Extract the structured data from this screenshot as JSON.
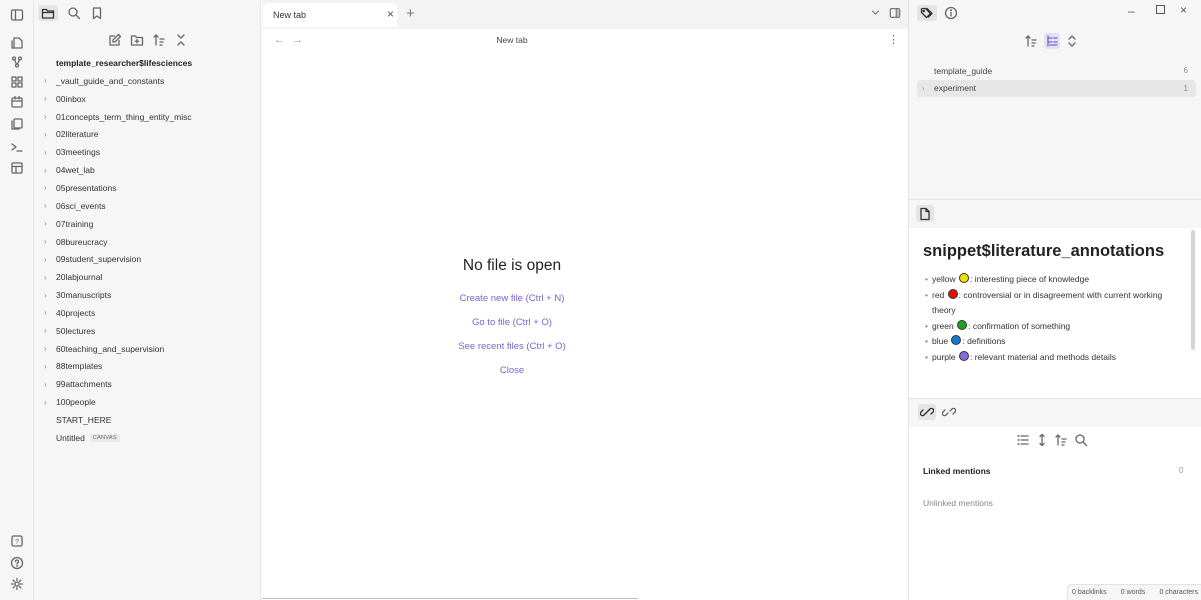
{
  "left_sidebar": {
    "vault_name": "template_researcher$lifesciences",
    "tree": [
      {
        "label": "_vault_guide_and_constants",
        "folder": true
      },
      {
        "label": "00inbox",
        "folder": true
      },
      {
        "label": "01concepts_term_thing_entity_misc",
        "folder": true
      },
      {
        "label": "02literature",
        "folder": true
      },
      {
        "label": "03meetings",
        "folder": true
      },
      {
        "label": "04wet_lab",
        "folder": true
      },
      {
        "label": "05presentations",
        "folder": true
      },
      {
        "label": "06sci_events",
        "folder": true
      },
      {
        "label": "07training",
        "folder": true
      },
      {
        "label": "08bureucracy",
        "folder": true
      },
      {
        "label": "09student_supervision",
        "folder": true
      },
      {
        "label": "20labjournal",
        "folder": true
      },
      {
        "label": "30manuscripts",
        "folder": true
      },
      {
        "label": "40projects",
        "folder": true
      },
      {
        "label": "50lectures",
        "folder": true
      },
      {
        "label": "60teaching_and_supervision",
        "folder": true
      },
      {
        "label": "88templates",
        "folder": true
      },
      {
        "label": "99attachments",
        "folder": true
      },
      {
        "label": "100people",
        "folder": true
      },
      {
        "label": "START_HERE",
        "folder": false
      },
      {
        "label": "Untitled",
        "folder": false,
        "badge": "CANVAS"
      }
    ]
  },
  "main": {
    "tab_label": "New tab",
    "tab_close": "×",
    "tab_add": "+",
    "nav_back": "←",
    "nav_forward": "→",
    "view_title": "New tab",
    "more_options": "⋮",
    "empty_heading": "No file is open",
    "actions": [
      "Create new file (Ctrl + N)",
      "Go to file (Ctrl + O)",
      "See recent files (Ctrl + O)",
      "Close"
    ]
  },
  "right_sidebar": {
    "window_min": "–",
    "window_close": "×",
    "tags": [
      {
        "name": "template_guide",
        "count": "6",
        "expandable": false
      },
      {
        "name": "experiment",
        "count": "1",
        "expandable": true
      }
    ],
    "snippet": {
      "title": "snippet$literature_annotations",
      "items": [
        {
          "pre": "yellow ",
          "color": "#f0e000",
          "text": ": interesting piece of knowledge"
        },
        {
          "pre": "red ",
          "color": "#e01010",
          "text": ": controversial or in disagreement  with current working theory"
        },
        {
          "pre": "green ",
          "color": "#20a020",
          "text": ": confirmation of something"
        },
        {
          "pre": "blue ",
          "color": "#1478d4",
          "text": ": definitions"
        },
        {
          "pre": "purple ",
          "color": "#8a6ae0",
          "text": ": relevant material and methods details"
        }
      ]
    },
    "backlinks": {
      "linked_label": "Linked mentions",
      "linked_count": "0",
      "unlinked_label": "Unlinked mentions"
    },
    "status": {
      "backlinks": "0 backlinks",
      "words": "0 words",
      "characters": "0 characters"
    }
  },
  "colors": {
    "accent": "#7c5fd6",
    "sidebar_bg": "#f6f6f6"
  }
}
